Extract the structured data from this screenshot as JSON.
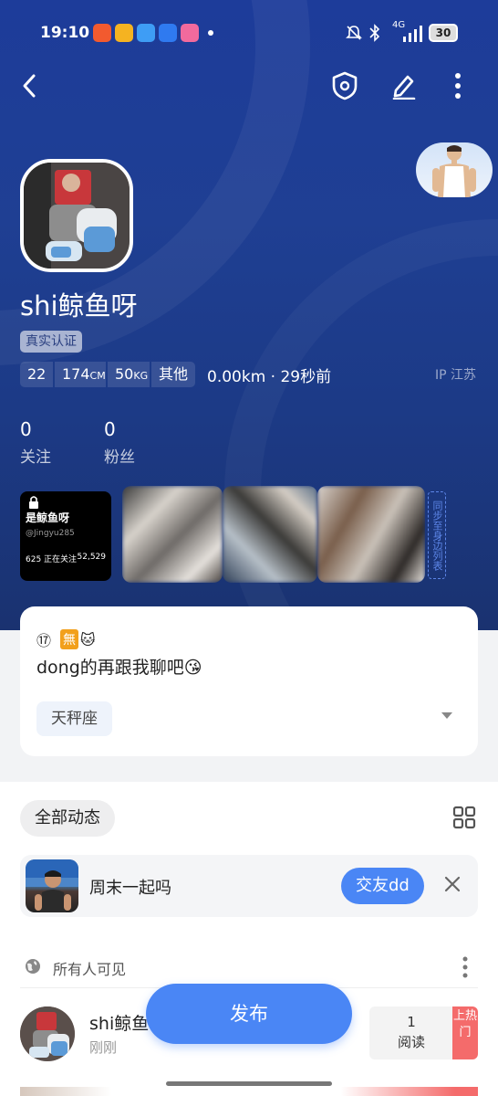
{
  "status_bar": {
    "time": "19:10",
    "network": "4G",
    "battery": "30",
    "app_icons": [
      {
        "name": "video-app-icon",
        "color": "#f25a2f"
      },
      {
        "name": "notes-app-icon",
        "color": "#f5b321"
      },
      {
        "name": "browser-app-icon",
        "color": "#3e9df5"
      },
      {
        "name": "cloud-app-icon",
        "color": "#2f7af0"
      },
      {
        "name": "bilibili-app-icon",
        "color": "#f26a9d"
      }
    ]
  },
  "header": {
    "back_icon": "chevron-left-icon",
    "shield_icon": "shield-icon",
    "edit_icon": "edit-icon",
    "more_icon": "more-vertical-icon"
  },
  "profile": {
    "username": "shi鲸鱼呀",
    "verified_label": "真实认证",
    "age": "22",
    "height_value": "174",
    "height_unit": "CM",
    "weight_value": "50",
    "weight_unit": "KG",
    "role": "其他",
    "distance_time": "0.00km · 29秒前",
    "ip_location": "IP 江苏",
    "following_count": "0",
    "following_label": "关注",
    "followers_count": "0",
    "followers_label": "粉丝"
  },
  "thumb_card": {
    "name": "是鲸鱼呀",
    "handle": "@Jingyu285",
    "following": "625 正在关注",
    "followers": "52,529"
  },
  "sync_tag": "同步至身边列表",
  "bio": {
    "number_badge": "⑰",
    "tag_wu": "無",
    "cat_emoji": "🐱",
    "text": "dong的再跟我聊吧😘",
    "zodiac": "天秤座"
  },
  "feed": {
    "filter_label": "全部动态",
    "suggestion_text": "周末一起吗",
    "suggestion_button": "交友dd",
    "visibility_label": "所有人可见",
    "post_name": "shi鲸鱼",
    "post_time": "刚刚",
    "read_count": "1",
    "read_label": "阅读",
    "hot_label": "上热门"
  },
  "publish_label": "发布"
}
